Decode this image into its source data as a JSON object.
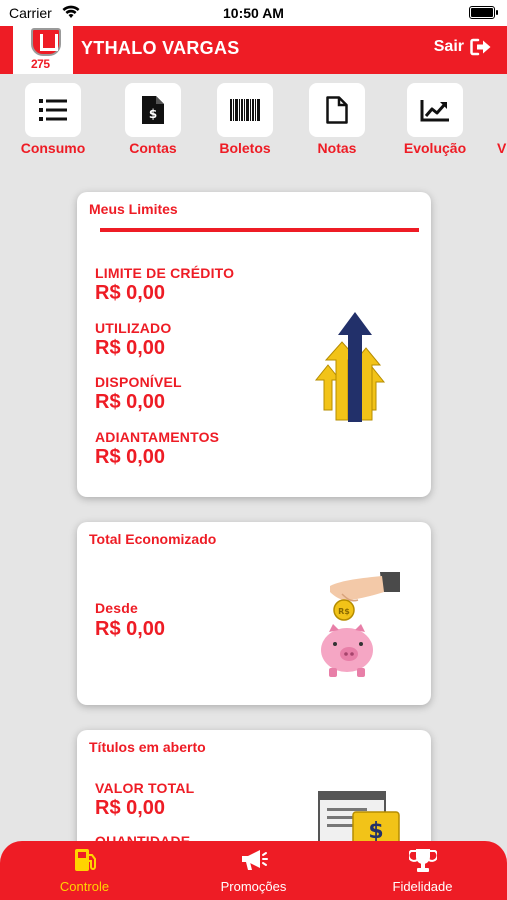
{
  "status_bar": {
    "carrier": "Carrier",
    "time": "10:50 AM"
  },
  "header": {
    "logo_number": "275",
    "user_name": "YTHALO VARGAS",
    "logout_label": "Sair"
  },
  "nav": {
    "items": [
      {
        "label": "Consumo",
        "icon": "list-icon"
      },
      {
        "label": "Contas",
        "icon": "invoice-dollar-icon"
      },
      {
        "label": "Boletos",
        "icon": "barcode-icon"
      },
      {
        "label": "Notas",
        "icon": "document-icon"
      },
      {
        "label": "Evolução",
        "icon": "chart-line-icon"
      }
    ]
  },
  "limits": {
    "title": "Meus Limites",
    "fields": [
      {
        "label": "LIMITE DE CRÉDITO",
        "value": "R$ 0,00"
      },
      {
        "label": "UTILIZADO",
        "value": "R$ 0,00"
      },
      {
        "label": "DISPONÍVEL",
        "value": "R$ 0,00"
      },
      {
        "label": "ADIANTAMENTOS",
        "value": "R$ 0,00"
      }
    ]
  },
  "savings": {
    "title": "Total Economizado",
    "label": "Desde",
    "value": "R$ 0,00",
    "coin_text": "R$"
  },
  "open_titles": {
    "title": "Títulos em aberto",
    "total_label": "VALOR TOTAL",
    "total_value": "R$ 0,00",
    "quantity_label": "QUANTIDADE",
    "money_symbol": "$"
  },
  "tabs": [
    {
      "label": "Controle",
      "icon": "gas-pump-icon",
      "active": true
    },
    {
      "label": "Promoções",
      "icon": "megaphone-icon",
      "active": false
    },
    {
      "label": "Fidelidade",
      "icon": "trophy-icon",
      "active": false
    }
  ],
  "colors": {
    "brand_red": "#ee1c25",
    "active_tab": "#ffd400",
    "background": "#e5e5e5"
  }
}
